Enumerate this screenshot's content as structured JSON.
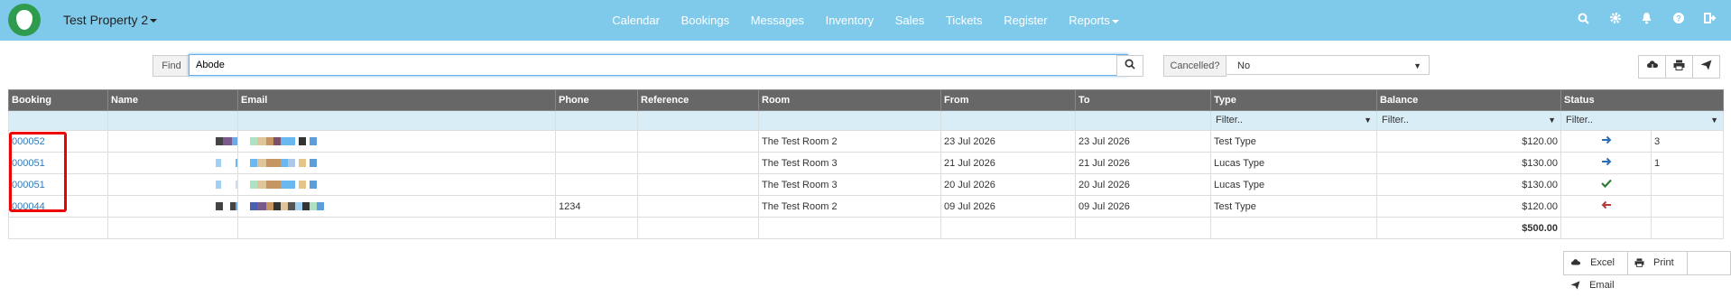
{
  "navbar": {
    "property": "Test Property 2",
    "links": [
      "Calendar",
      "Bookings",
      "Messages",
      "Inventory",
      "Sales",
      "Tickets",
      "Register",
      "Reports"
    ],
    "icons": [
      "search-icon",
      "gear-icon",
      "bell-icon",
      "help-icon",
      "logout-icon"
    ]
  },
  "search": {
    "label": "Find",
    "value": "Abode"
  },
  "cancelled": {
    "label": "Cancelled?",
    "value": "No"
  },
  "columns": [
    "Booking",
    "Name",
    "Email",
    "Phone",
    "Reference",
    "Room",
    "From",
    "To",
    "Type",
    "Balance",
    "Status"
  ],
  "filters": {
    "type": "Filter..",
    "balance": "Filter..",
    "status": "Filter.."
  },
  "rows": [
    {
      "booking": "000052",
      "phone": "",
      "room": "The Test Room 2",
      "from": "23 Jul 2026",
      "to": "23 Jul 2026",
      "type": "Test Type",
      "balance": "$120.00",
      "status_icon": "arrow-right-icon",
      "count": "3"
    },
    {
      "booking": "000051",
      "phone": "",
      "room": "The Test Room 3",
      "from": "21 Jul 2026",
      "to": "21 Jul 2026",
      "type": "Lucas Type",
      "balance": "$130.00",
      "status_icon": "arrow-right-icon",
      "count": "1"
    },
    {
      "booking": "000051",
      "phone": "",
      "room": "The Test Room 3",
      "from": "20 Jul 2026",
      "to": "20 Jul 2026",
      "type": "Lucas Type",
      "balance": "$130.00",
      "status_icon": "check-icon",
      "count": ""
    },
    {
      "booking": "000044",
      "phone": "1234",
      "room": "The Test Room 2",
      "from": "09 Jul 2026",
      "to": "09 Jul 2026",
      "type": "Test Type",
      "balance": "$120.00",
      "status_icon": "arrow-left-icon",
      "count": ""
    }
  ],
  "total": "$500.00",
  "export": {
    "excel": "Excel",
    "print": "Print",
    "email": "Email"
  },
  "colors": {
    "navbar": "#7fcaeb",
    "header": "#676767",
    "filter_row": "#d9edf7",
    "link": "#337ab7",
    "highlight": "#e00000"
  }
}
